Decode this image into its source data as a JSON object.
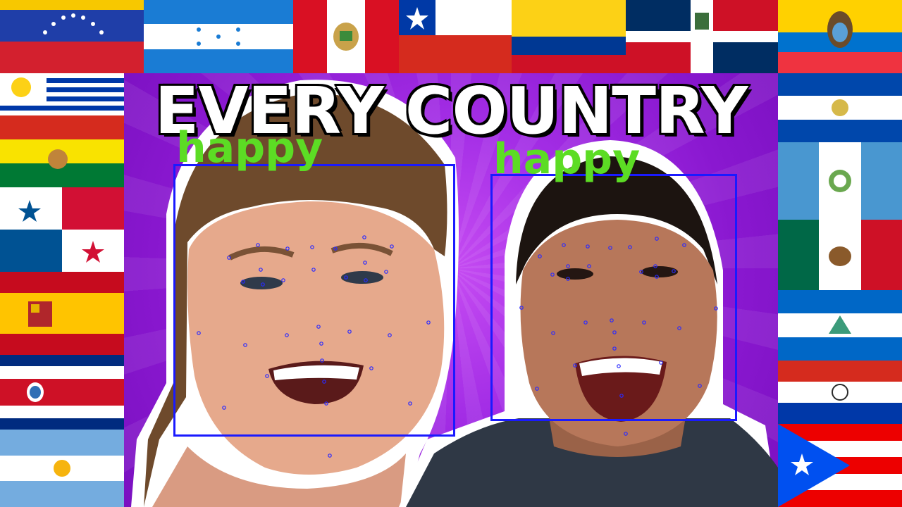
{
  "title": "EVERY COUNTRY",
  "detections": [
    {
      "label": "happy",
      "box_color": "#1a1aff",
      "label_color": "#5cdc24"
    },
    {
      "label": "happy",
      "box_color": "#1a1aff",
      "label_color": "#5cdc24"
    }
  ],
  "flags": [
    "venezuela-flag",
    "honduras-flag",
    "peru-flag",
    "chile-flag",
    "colombia-flag",
    "dominican-republic-flag",
    "ecuador-flag",
    "uruguay-flag",
    "bolivia-flag",
    "panama-flag",
    "spain-flag",
    "costa-rica-flag",
    "argentina-flag",
    "el-salvador-flag",
    "guatemala-flag",
    "mexico-flag",
    "nicaragua-flag",
    "paraguay-flag",
    "puerto-rico-flag"
  ],
  "colors": {
    "background": "#a42ee6",
    "box": "#1a1aff",
    "label": "#5cdc24"
  }
}
